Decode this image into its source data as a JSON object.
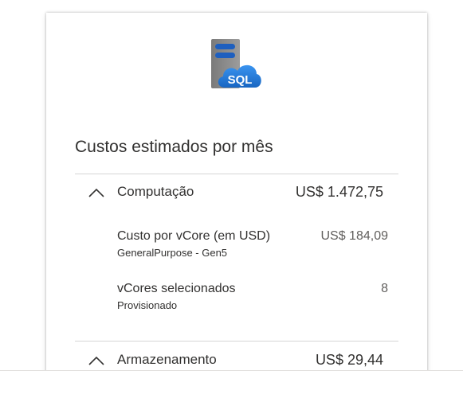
{
  "header": {
    "logo_text": "SQL",
    "title": "Custos estimados por mês"
  },
  "sections": [
    {
      "label": "Computação",
      "amount": "US$ 1.472,75",
      "expanded": true,
      "items": [
        {
          "label": "Custo por vCore (em USD)",
          "sub": "GeneralPurpose - Gen5",
          "value": "US$ 184,09"
        },
        {
          "label": "vCores selecionados",
          "sub": "Provisionado",
          "value": "8"
        }
      ]
    },
    {
      "label": "Armazenamento",
      "amount": "US$ 29,44",
      "expanded": true
    }
  ],
  "colors": {
    "text": "#323130",
    "muted_value": "#605e5c",
    "divider": "#d6d6d6",
    "logo_blue": "#1e74d4"
  },
  "icons": {
    "logo": "sql-database-icon",
    "chevron": "chevron-up-icon"
  }
}
